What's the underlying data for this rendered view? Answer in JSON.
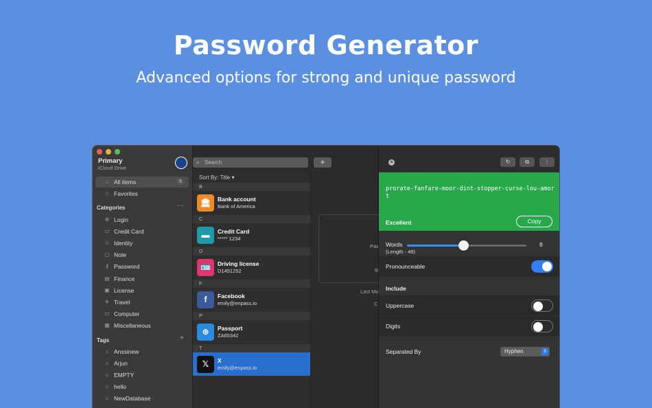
{
  "hero": {
    "title": "Password Generator",
    "subtitle": "Advanced options for strong and unique password"
  },
  "sidebar": {
    "vault_name": "Primary",
    "vault_location": "iCloud Drive",
    "all_items": {
      "label": "All items",
      "count": "6"
    },
    "favorites": "Favorites",
    "categories_header": "Categories",
    "categories_action": "···",
    "categories": [
      "Login",
      "Credit Card",
      "Identity",
      "Note",
      "Password",
      "Finance",
      "License",
      "Travel",
      "Computer",
      "Miscellaneous"
    ],
    "tags_header": "Tags",
    "tags_action": "+",
    "tags": [
      "Anssinew",
      "Arjun",
      "EMPTY",
      "hello",
      "NewDatabase"
    ]
  },
  "toolbar": {
    "search_placeholder": "Search",
    "add_label": "+"
  },
  "list": {
    "sort_label": "Sort By:",
    "sort_value": "Title",
    "sections": [
      "B",
      "C",
      "D",
      "F",
      "P",
      "T"
    ],
    "items": [
      {
        "title": "Bank account",
        "subtitle": "Bank of America",
        "icon": "bank-icon",
        "glyph": "🏛",
        "color": "#f08a24"
      },
      {
        "title": "Credit Card",
        "subtitle": "***** 1234",
        "icon": "card-icon",
        "glyph": "▬",
        "color": "#1e9aa8"
      },
      {
        "title": "Driving license",
        "subtitle": "D1451252",
        "icon": "id-card-icon",
        "glyph": "🪪",
        "color": "#e0356e"
      },
      {
        "title": "Facebook",
        "subtitle": "emily@enpass.io",
        "icon": "facebook-icon",
        "glyph": "f",
        "color": "#3b5a9a"
      },
      {
        "title": "Passport",
        "subtitle": "ZA65342",
        "icon": "globe-icon",
        "glyph": "⊕",
        "color": "#2a8ce0"
      },
      {
        "title": "X",
        "subtitle": "emily@enpass.io",
        "icon": "x-logo-icon",
        "glyph": "𝕏",
        "color": "#111111"
      }
    ]
  },
  "detail": {
    "labels": [
      "Pas",
      "W",
      "Last Mo",
      "C"
    ]
  },
  "generator": {
    "password": "prorate-fanfare-moor-dint-stopper-curse-lou-amort",
    "strength": "Excellent",
    "copy_label": "Copy",
    "words_label": "Words",
    "length_label": "(Length - 49)",
    "words_value": "8",
    "words_fraction": 0.47,
    "pronounceable_label": "Pronounceable",
    "pronounceable_on": true,
    "include_header": "Include",
    "uppercase_label": "Uppercase",
    "uppercase_on": false,
    "digits_label": "Digits",
    "digits_on": false,
    "separated_label": "Separated By",
    "separator_value": "Hyphen",
    "strength_color": "#28a74b",
    "accent_color": "#2f7ff0"
  }
}
